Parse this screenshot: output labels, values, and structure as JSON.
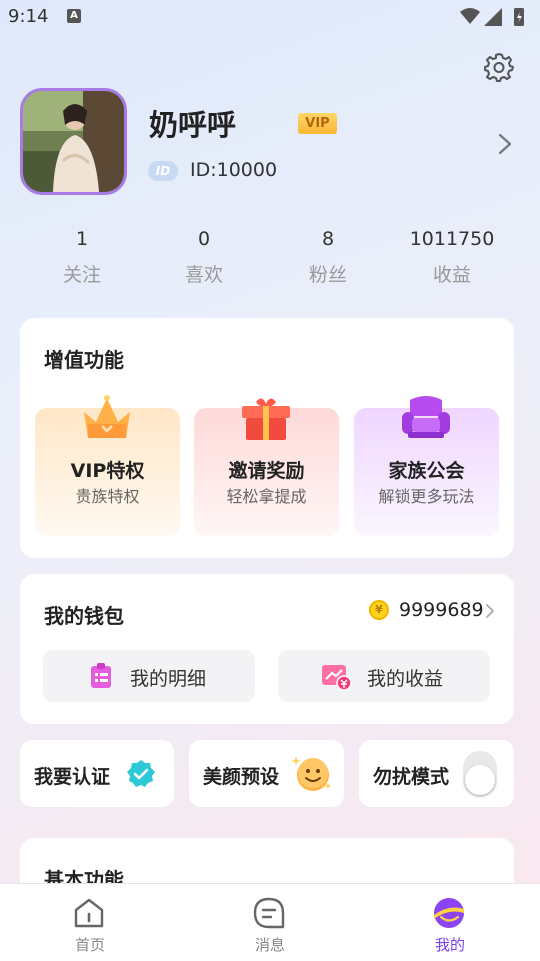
{
  "status": {
    "time": "9:14",
    "notification_letter": "A"
  },
  "profile": {
    "name": "奶呼呼",
    "vip_label": "VIP",
    "id_badge": "ID",
    "id_text": "ID:10000"
  },
  "stats": [
    {
      "value": "1",
      "label": "关注"
    },
    {
      "value": "0",
      "label": "喜欢"
    },
    {
      "value": "8",
      "label": "粉丝"
    },
    {
      "value": "1011750",
      "label": "收益"
    }
  ],
  "value_added": {
    "title": "增值功能",
    "items": [
      {
        "title": "VIP特权",
        "subtitle": "贵族特权",
        "icon": "crown-icon"
      },
      {
        "title": "邀请奖励",
        "subtitle": "轻松拿提成",
        "icon": "gift-icon"
      },
      {
        "title": "家族公会",
        "subtitle": "解锁更多玩法",
        "icon": "sofa-icon"
      }
    ]
  },
  "wallet": {
    "title": "我的钱包",
    "coin_symbol": "¥",
    "balance": "9999689",
    "details_label": "我的明细",
    "earnings_label": "我的收益"
  },
  "quick": {
    "verify_label": "我要认证",
    "beauty_label": "美颜预设",
    "dnd_label": "勿扰模式",
    "dnd_on": false
  },
  "basic": {
    "title": "基本功能"
  },
  "nav": {
    "home": "首页",
    "messages": "消息",
    "mine": "我的",
    "active": "mine",
    "active_color": "#7b3ff2",
    "inactive_color": "#888888"
  }
}
